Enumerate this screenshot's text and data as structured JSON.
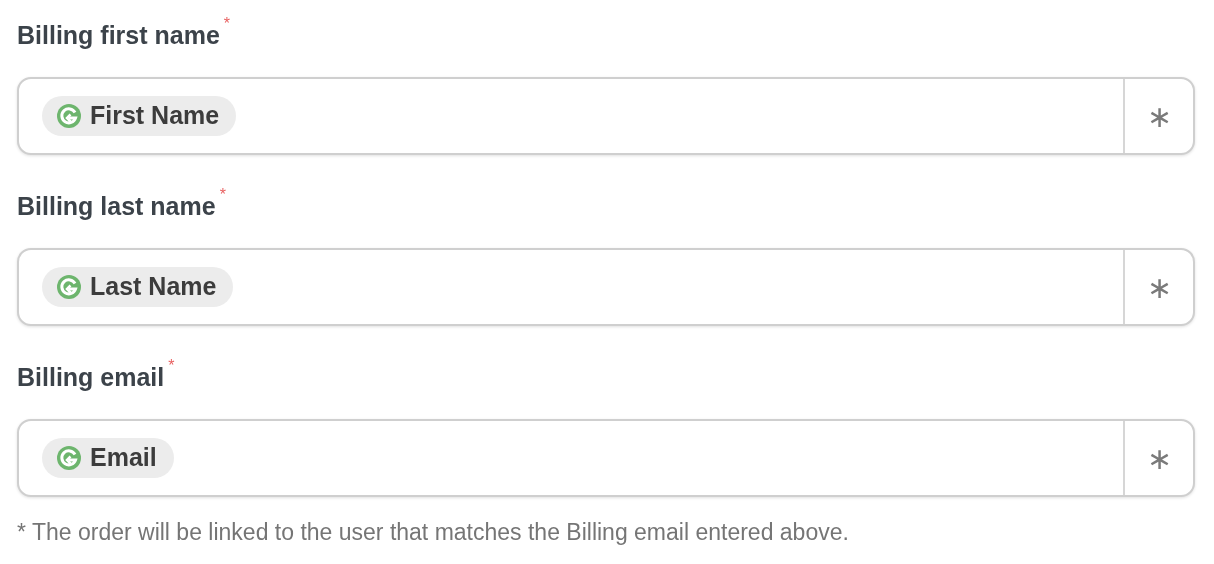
{
  "fields": [
    {
      "label": "Billing first name",
      "required_mark": "*",
      "tag": "First Name",
      "button": "∗"
    },
    {
      "label": "Billing last name",
      "required_mark": "*",
      "tag": "Last Name",
      "button": "∗"
    },
    {
      "label": "Billing email",
      "required_mark": "*",
      "tag": "Email",
      "button": "∗"
    }
  ],
  "note": "* The order will be linked to the user that matches the Billing email entered above."
}
